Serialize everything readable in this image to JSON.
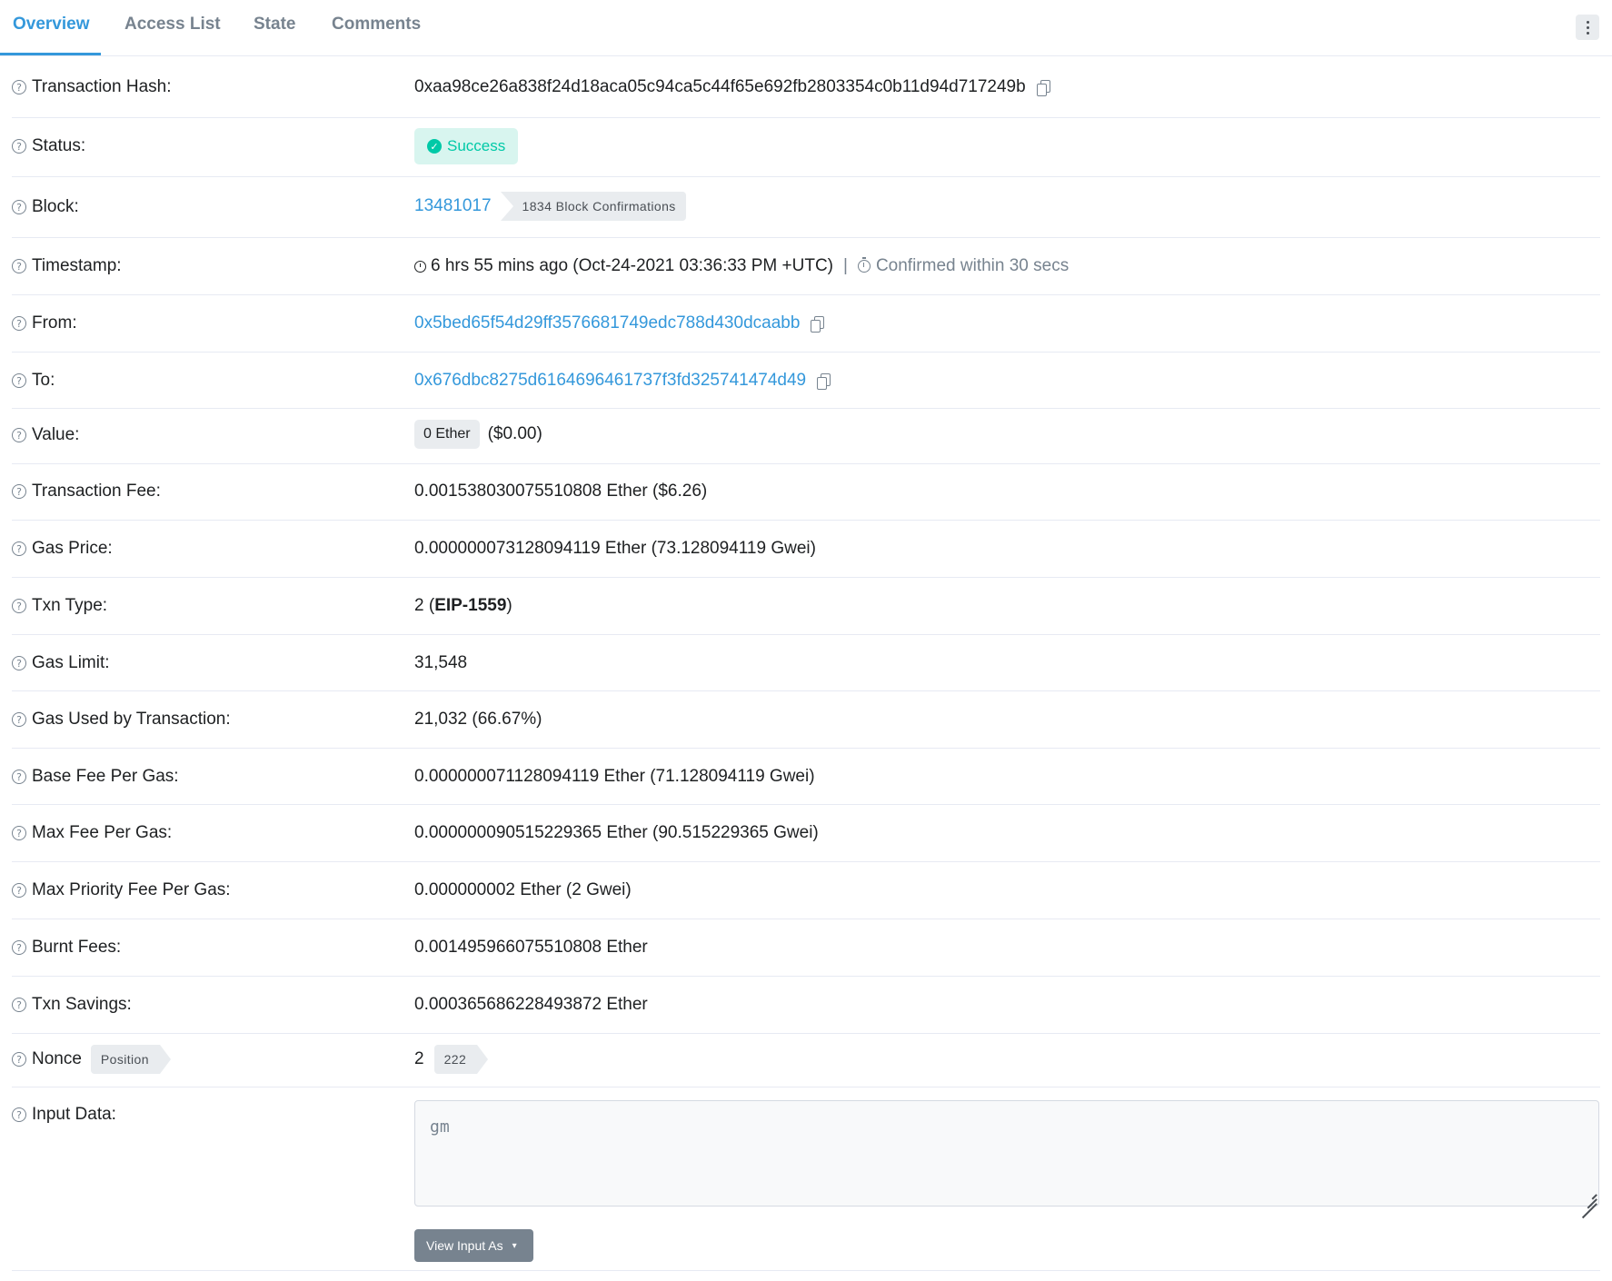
{
  "tabs": [
    {
      "label": "Overview",
      "active": true
    },
    {
      "label": "Access List",
      "active": false
    },
    {
      "label": "State",
      "active": false
    },
    {
      "label": "Comments",
      "active": false
    }
  ],
  "colors": {
    "accent": "#3498db",
    "success": "#00c9a7",
    "muted": "#77838f"
  },
  "rows": {
    "tx_hash": {
      "label": "Transaction Hash:",
      "value": "0xaa98ce26a838f24d18aca05c94ca5c44f65e692fb2803354c0b11d94d717249b"
    },
    "status": {
      "label": "Status:",
      "value": "Success"
    },
    "block": {
      "label": "Block:",
      "number": "13481017",
      "confirmations": "1834 Block Confirmations"
    },
    "timestamp": {
      "label": "Timestamp:",
      "value": "6 hrs 55 mins ago (Oct-24-2021 03:36:33 PM +UTC)",
      "separator": "|",
      "confirmed": "Confirmed within 30 secs"
    },
    "from": {
      "label": "From:",
      "value": "0x5bed65f54d29ff3576681749edc788d430dcaabb"
    },
    "to": {
      "label": "To:",
      "value": "0x676dbc8275d6164696461737f3fd325741474d49"
    },
    "value": {
      "label": "Value:",
      "ether": "0 Ether",
      "usd": "($0.00)"
    },
    "tx_fee": {
      "label": "Transaction Fee:",
      "value": "0.001538030075510808 Ether ($6.26)"
    },
    "gas_price": {
      "label": "Gas Price:",
      "value": "0.000000073128094119 Ether (73.128094119 Gwei)"
    },
    "txn_type": {
      "label": "Txn Type:",
      "prefix": "2 (",
      "type": "EIP-1559",
      "suffix": ")"
    },
    "gas_limit": {
      "label": "Gas Limit:",
      "value": "31,548"
    },
    "gas_used": {
      "label": "Gas Used by Transaction:",
      "value": "21,032 (66.67%)"
    },
    "base_fee": {
      "label": "Base Fee Per Gas:",
      "value": "0.000000071128094119 Ether (71.128094119 Gwei)"
    },
    "max_fee": {
      "label": "Max Fee Per Gas:",
      "value": "0.000000090515229365 Ether (90.515229365 Gwei)"
    },
    "max_priority": {
      "label": "Max Priority Fee Per Gas:",
      "value": "0.000000002 Ether (2 Gwei)"
    },
    "burnt_fees": {
      "label": "Burnt Fees:",
      "value": "0.001495966075510808 Ether"
    },
    "txn_savings": {
      "label": "Txn Savings:",
      "value": "0.000365686228493872 Ether"
    },
    "nonce": {
      "label": "Nonce",
      "position_tag": "Position",
      "value": "2",
      "position": "222"
    },
    "input_data": {
      "label": "Input Data:",
      "value": "gm",
      "button": "View Input As"
    }
  }
}
